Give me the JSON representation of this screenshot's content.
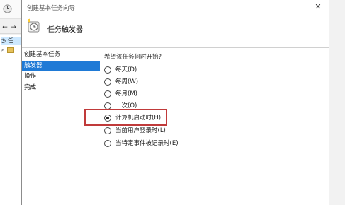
{
  "wizard": {
    "window_title": "创建基本任务向导",
    "close_label": "✕",
    "header_title": "任务触发器",
    "steps": [
      {
        "label": "创建基本任务"
      },
      {
        "label": "触发器"
      },
      {
        "label": "操作"
      },
      {
        "label": "完成"
      }
    ],
    "active_step": "触发器",
    "question": "希望该任务何时开始?",
    "options": [
      {
        "label": "每天(D)",
        "checked": false
      },
      {
        "label": "每周(W)",
        "checked": false
      },
      {
        "label": "每月(M)",
        "checked": false
      },
      {
        "label": "一次(O)",
        "checked": false
      },
      {
        "label": "计算机启动时(H)",
        "checked": true
      },
      {
        "label": "当前用户登录时(L)",
        "checked": false
      },
      {
        "label": "当特定事件被记录时(E)",
        "checked": false
      }
    ]
  },
  "background": {
    "nav_back": "←",
    "nav_forward": "→",
    "tree_row_1": "任",
    "tree_row_2": "▹"
  },
  "colors": {
    "active_step_bg": "#1f7ad6",
    "highlight_border": "#c03a3a"
  }
}
